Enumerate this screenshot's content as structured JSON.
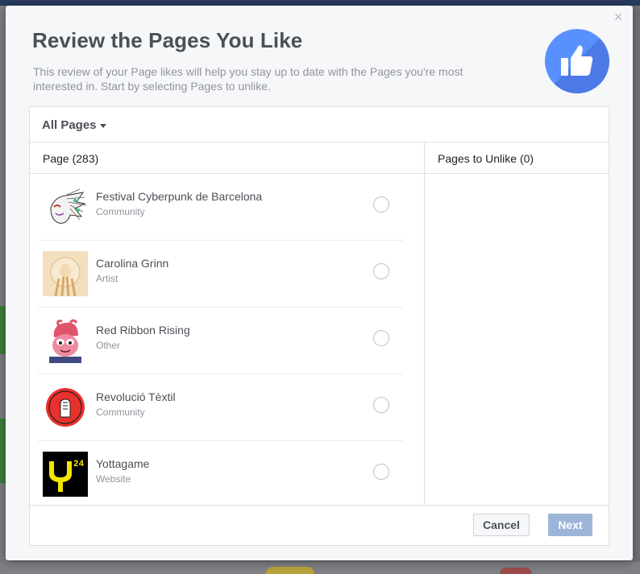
{
  "dialog": {
    "title": "Review the Pages You Like",
    "subtitle": "This review of your Page likes will help you stay up to date with the Pages you're most interested in. Start by selecting Pages to unlike.",
    "close_label": "×",
    "filter_label": "All Pages",
    "left_header": "Page (283)",
    "right_header": "Pages to Unlike (0)",
    "pages": [
      {
        "name": "Festival Cyberpunk de Barcelona",
        "category": "Community",
        "icon": "festival-cyberpunk-avatar-icon"
      },
      {
        "name": "Carolina Grinn",
        "category": "Artist",
        "icon": "carolina-grinn-avatar-icon"
      },
      {
        "name": "Red Ribbon Rising",
        "category": "Other",
        "icon": "red-ribbon-rising-avatar-icon"
      },
      {
        "name": "Revolució Tèxtil",
        "category": "Community",
        "icon": "revolucio-textil-avatar-icon"
      },
      {
        "name": "Yottagame",
        "category": "Website",
        "icon": "yottagame-avatar-icon",
        "logo_text": "Y",
        "logo_superscript": "24"
      }
    ],
    "buttons": {
      "cancel": "Cancel",
      "next": "Next"
    }
  },
  "colors": {
    "accent": "#5890ff",
    "next_disabled": "#9cb4d8",
    "title": "#4b4f56",
    "muted": "#90949c"
  }
}
